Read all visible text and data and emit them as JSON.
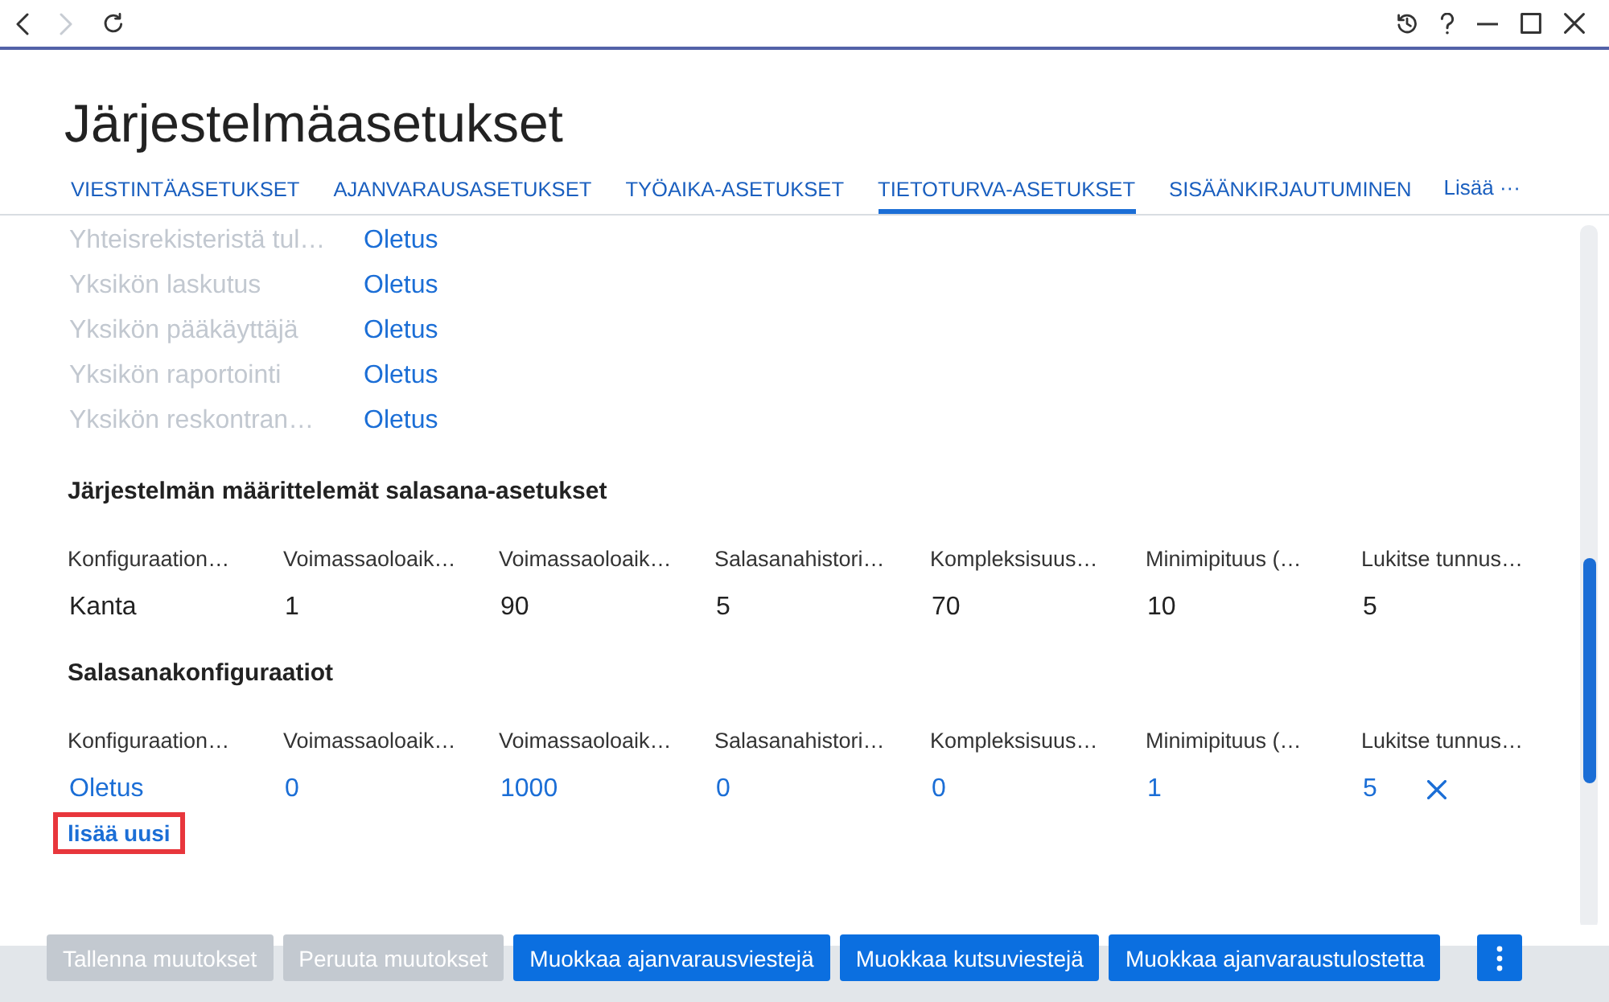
{
  "nav": [
    {
      "kind": "back",
      "disabled": false
    },
    {
      "kind": "forward",
      "disabled": true
    },
    {
      "kind": "refresh",
      "disabled": false
    }
  ],
  "title": "Järjestelmäasetukset",
  "tabs": [
    {
      "label": "VIESTINTÄASETUKSET",
      "selected": false
    },
    {
      "label": "AJANVARAUSASETUKSET",
      "selected": false
    },
    {
      "label": "TYÖAIKA-ASETUKSET",
      "selected": false
    },
    {
      "label": "TIETOTURVA-ASETUKSET",
      "selected": true
    },
    {
      "label": "SISÄÄNKIRJAUTUMINEN",
      "selected": false
    }
  ],
  "more_tab": {
    "label": "Lisää ···"
  },
  "settings_list": [
    {
      "label": "Yhteisrekisteristä tul…",
      "value": "Oletus"
    },
    {
      "label": "Yksikön laskutus",
      "value": "Oletus"
    },
    {
      "label": "Yksikön pääkäyttäjä",
      "value": "Oletus"
    },
    {
      "label": "Yksikön raportointi",
      "value": "Oletus"
    },
    {
      "label": "Yksikön reskontran…",
      "value": "Oletus"
    }
  ],
  "tables": [
    {
      "title": "Järjestelmän määrittelemät salasana-asetukset",
      "kind": "readonly",
      "columns": [
        "Konfiguraation…",
        "Voimassaoloaik…",
        "Voimassaoloaik…",
        "Salasanahistori…",
        "Kompleksisuus…",
        "Minimipituus (…",
        "Lukitse tunnus…"
      ],
      "rows": [
        [
          "Kanta",
          "1",
          "90",
          "5",
          "70",
          "10",
          "5"
        ]
      ]
    },
    {
      "title": "Salasanakonfiguraatiot",
      "kind": "editable",
      "columns": [
        "Konfiguraation…",
        "Voimassaoloaik…",
        "Voimassaoloaik…",
        "Salasanahistori…",
        "Kompleksisuus…",
        "Minimipituus (…",
        "Lukitse tunnus…"
      ],
      "rows": [
        [
          "Oletus",
          "0",
          "1000",
          "0",
          "0",
          "1",
          "5"
        ]
      ]
    }
  ],
  "add_link": {
    "label": "lisää uusi",
    "highlighted": true
  },
  "footer_buttons": [
    {
      "label": "Tallenna muutokset",
      "disabled": true
    },
    {
      "label": "Peruuta muutokset",
      "disabled": true
    },
    {
      "label": "Muokkaa ajanvarausviestejä",
      "disabled": false
    },
    {
      "label": "Muokkaa kutsuviestejä",
      "disabled": false
    },
    {
      "label": "Muokkaa ajanvaraustulostetta",
      "disabled": false
    }
  ]
}
